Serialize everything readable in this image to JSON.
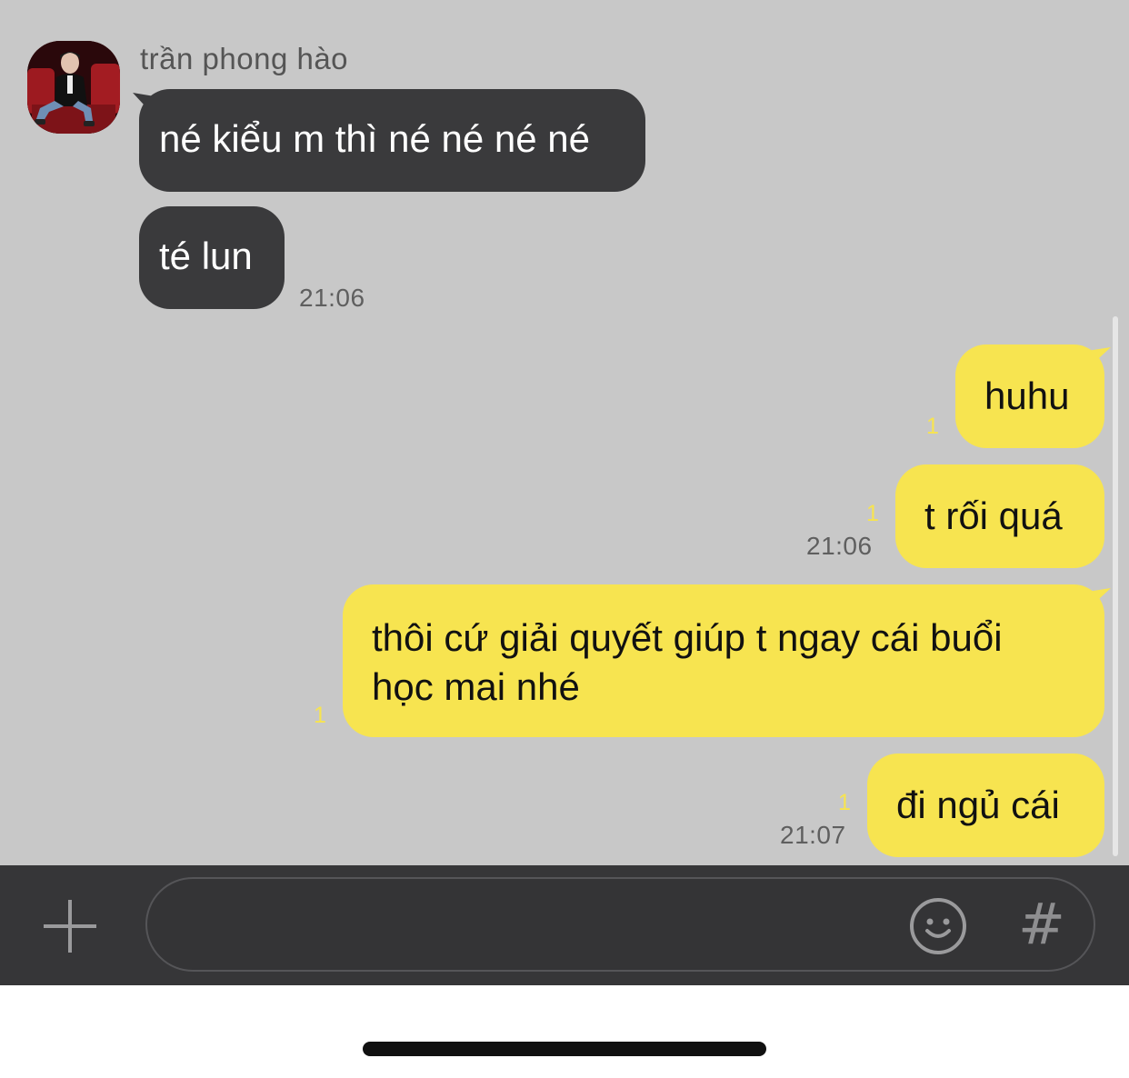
{
  "conversation": {
    "sender_name": "trần phong hào",
    "avatar_icon": "profile-photo",
    "incoming": [
      {
        "text": "né kiểu m thì né né né né"
      },
      {
        "text": "té lun",
        "time": "21:06"
      }
    ],
    "outgoing": [
      {
        "text": "huhu",
        "unread": "1"
      },
      {
        "text": "t rối quá",
        "unread": "1",
        "time": "21:06"
      },
      {
        "text_line1": "thôi cứ giải quyết giúp t ngay cái buổi",
        "text_line2": "học mai nhé",
        "unread": "1"
      },
      {
        "text": "đi ngủ cái",
        "unread": "1",
        "time": "21:07"
      }
    ]
  },
  "input_bar": {
    "plus_icon": "plus-icon",
    "emoji_icon": "emoji-smile-icon",
    "hash_label": "#",
    "message_value": ""
  },
  "colors": {
    "chat_background": "#c8c8c8",
    "incoming_bubble": "#3a3a3c",
    "outgoing_bubble": "#f7e450",
    "unread_badge": "#f7e450",
    "input_bar": "#363638"
  }
}
